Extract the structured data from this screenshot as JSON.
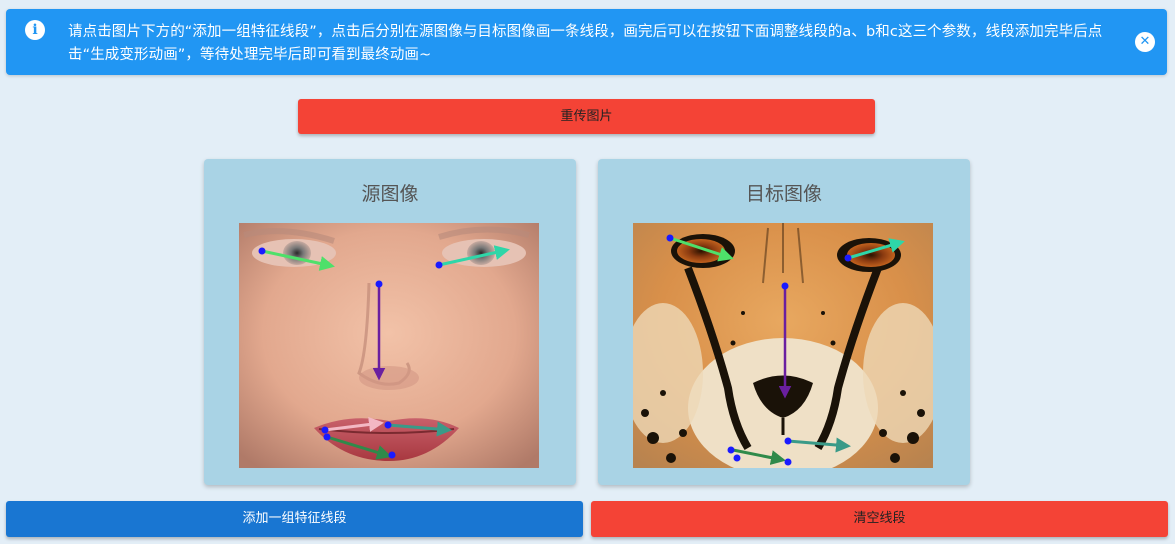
{
  "alert": {
    "icon": "info-icon",
    "message": "请点击图片下方的“添加一组特征线段”，点击后分别在源图像与目标图像画一条线段，画完后可以在按钮下面调整线段的a、b和c这三个参数，线段添加完毕后点击“生成变形动画”，等待处理完毕后即可看到最终动画~",
    "close_icon": "close-icon",
    "color": "#2196f3"
  },
  "buttons": {
    "reupload": "重传图片",
    "add_segment": "添加一组特征线段",
    "clear_segments": "清空线段"
  },
  "panels": {
    "source": {
      "title": "源图像",
      "image": "human-face-photo"
    },
    "target": {
      "title": "目标图像",
      "image": "cheetah-face-photo"
    }
  },
  "colors": {
    "primary": "#1976d2",
    "danger": "#f44336",
    "card": "#a9d3e5",
    "background": "#e3eef7",
    "segment_green": "#4ee06a",
    "segment_teal": "#2ed6a8",
    "segment_purple": "#6a1fa0",
    "segment_pink": "#f3b8c4",
    "segment_darkteal": "#3a9a88",
    "segment_darkgreen": "#2f8a4a",
    "endpoint": "#1a1aff"
  }
}
